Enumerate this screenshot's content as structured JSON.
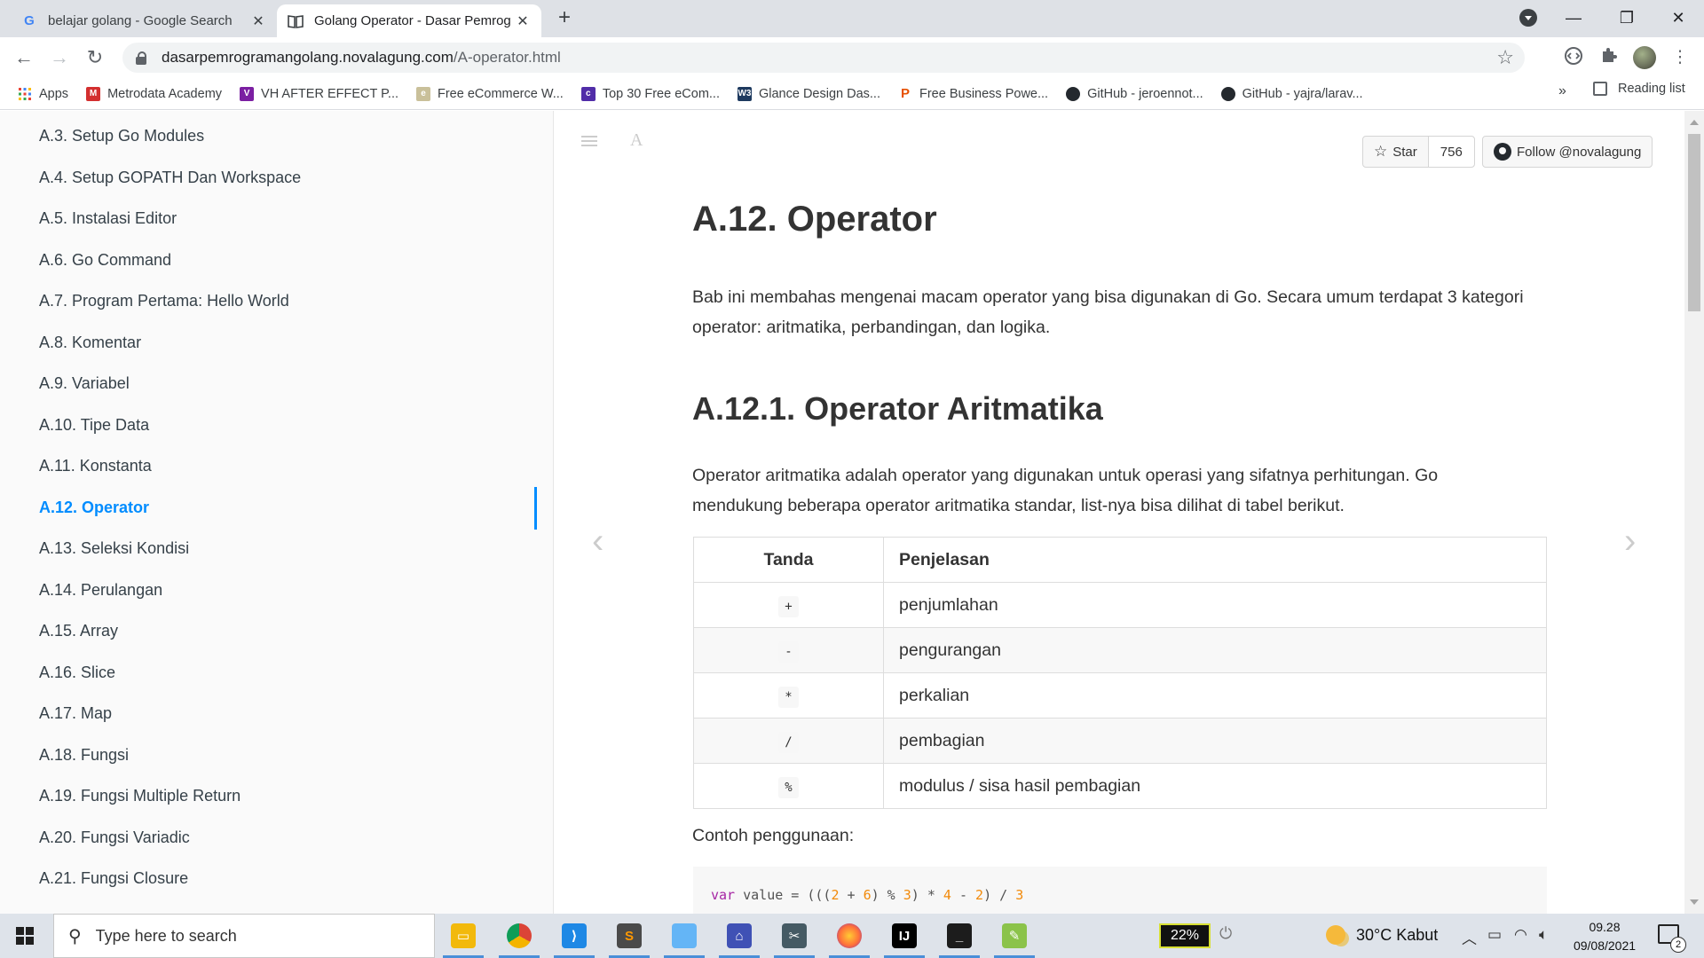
{
  "browser": {
    "tabs": [
      {
        "title": "belajar golang - Google Search",
        "icon": "google-g-icon",
        "active": false
      },
      {
        "title": "Golang Operator - Dasar Pemrog",
        "icon": "book-icon",
        "active": true
      }
    ],
    "url_host": "dasarpemrogramangolang.novalagung.com",
    "url_path": "/A-operator.html",
    "bookmarks": [
      {
        "label": "Apps",
        "icon": "apps-grid-icon",
        "color": "#1a73e8"
      },
      {
        "label": "Metrodata Academy",
        "icon": "metrodata-icon",
        "color": "#d32f2f"
      },
      {
        "label": "VH AFTER EFFECT P...",
        "icon": "vh-icon",
        "color": "#7b1fa2"
      },
      {
        "label": "Free eCommerce W...",
        "icon": "ecommerce-icon",
        "color": "#c9c09a"
      },
      {
        "label": "Top 30 Free eCom...",
        "icon": "colorlib-icon",
        "color": "#512da8"
      },
      {
        "label": "Glance Design Das...",
        "icon": "w3-icon",
        "color": "#1e3a5f"
      },
      {
        "label": "Free Business Powe...",
        "icon": "p-icon",
        "color": "#e65100"
      },
      {
        "label": "GitHub - jeroennot...",
        "icon": "github-icon",
        "color": "#24292e"
      },
      {
        "label": "GitHub - yajra/larav...",
        "icon": "github-icon",
        "color": "#24292e"
      }
    ],
    "bookmarks_more": "»",
    "reading_list": "Reading list"
  },
  "sidebar": {
    "items": [
      {
        "label": "A.3. Setup Go Modules",
        "active": false
      },
      {
        "label": "A.4. Setup GOPATH Dan Workspace",
        "active": false
      },
      {
        "label": "A.5. Instalasi Editor",
        "active": false
      },
      {
        "label": "A.6. Go Command",
        "active": false
      },
      {
        "label": "A.7. Program Pertama: Hello World",
        "active": false
      },
      {
        "label": "A.8. Komentar",
        "active": false
      },
      {
        "label": "A.9. Variabel",
        "active": false
      },
      {
        "label": "A.10. Tipe Data",
        "active": false
      },
      {
        "label": "A.11. Konstanta",
        "active": false
      },
      {
        "label": "A.12. Operator",
        "active": true
      },
      {
        "label": "A.13. Seleksi Kondisi",
        "active": false
      },
      {
        "label": "A.14. Perulangan",
        "active": false
      },
      {
        "label": "A.15. Array",
        "active": false
      },
      {
        "label": "A.16. Slice",
        "active": false
      },
      {
        "label": "A.17. Map",
        "active": false
      },
      {
        "label": "A.18. Fungsi",
        "active": false
      },
      {
        "label": "A.19. Fungsi Multiple Return",
        "active": false
      },
      {
        "label": "A.20. Fungsi Variadic",
        "active": false
      },
      {
        "label": "A.21. Fungsi Closure",
        "active": false
      }
    ]
  },
  "header": {
    "font_button": "A",
    "star_label": "Star",
    "star_count": "756",
    "follow_label": "Follow @novalagung"
  },
  "article": {
    "title": "A.12. Operator",
    "intro": "Bab ini membahas mengenai macam operator yang bisa digunakan di Go. Secara umum terdapat 3 kategori operator: aritmatika, perbandingan, dan logika.",
    "section_title": "A.12.1. Operator Aritmatika",
    "section_text": "Operator aritmatika adalah operator yang digunakan untuk operasi yang sifatnya perhitungan. Go mendukung beberapa operator aritmatika standar, list-nya bisa dilihat di tabel berikut.",
    "table": {
      "headers": [
        "Tanda",
        "Penjelasan"
      ],
      "rows": [
        {
          "sign": "+",
          "desc": "penjumlahan"
        },
        {
          "sign": "-",
          "desc": "pengurangan"
        },
        {
          "sign": "*",
          "desc": "perkalian"
        },
        {
          "sign": "/",
          "desc": "pembagian"
        },
        {
          "sign": "%",
          "desc": "modulus / sisa hasil pembagian"
        }
      ]
    },
    "example_label": "Contoh penggunaan:",
    "code": {
      "kw": "var",
      "ident": " value = (((",
      "n1": "2",
      "p1": " + ",
      "n2": "6",
      "p2": ") % ",
      "n3": "3",
      "p3": ") * ",
      "n4": "4",
      "p4": " - ",
      "n5": "2",
      "p5": ") / ",
      "n6": "3"
    }
  },
  "taskbar": {
    "search_placeholder": "Type here to search",
    "battery": "22%",
    "weather": "30°C  Kabut",
    "time": "09.28",
    "date": "09/08/2021",
    "notifications": "2",
    "apps": [
      {
        "icon": "file-explorer-icon",
        "color": "#f2b90c",
        "running": true
      },
      {
        "icon": "chrome-icon",
        "color": "#db4437",
        "running": true
      },
      {
        "icon": "vscode-icon",
        "color": "#1e88e5",
        "running": true
      },
      {
        "icon": "sublime-text-icon",
        "color": "#ff9800",
        "running": true
      },
      {
        "icon": "notepad-icon",
        "color": "#64b5f6",
        "running": true
      },
      {
        "icon": "network-app-icon",
        "color": "#3f51b5",
        "running": true
      },
      {
        "icon": "snipping-tool-icon",
        "color": "#455a64",
        "running": true
      },
      {
        "icon": "firefox-icon",
        "color": "#ff7139",
        "running": true
      },
      {
        "icon": "jetbrains-icon",
        "color": "#000000",
        "running": true
      },
      {
        "icon": "terminal-icon",
        "color": "#1c1c1c",
        "running": true
      },
      {
        "icon": "paint-icon",
        "color": "#8bc34a",
        "running": true
      }
    ]
  }
}
